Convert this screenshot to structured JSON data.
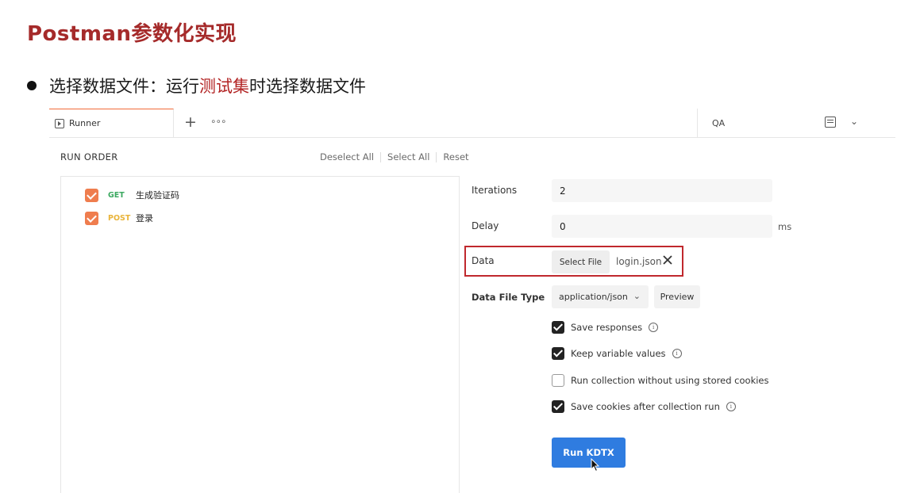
{
  "slide": {
    "title": "Postman参数化实现",
    "bullet_prefix": "选择数据文件：运行",
    "bullet_highlight": "测试集",
    "bullet_suffix": "时选择数据文件"
  },
  "tabs": {
    "runner_label": "Runner",
    "add_tab": "+",
    "more": "∘∘∘",
    "environment": "QA",
    "environment_chevron": "⌄"
  },
  "run_order": {
    "title": "RUN ORDER",
    "deselect_all": "Deselect All",
    "select_all": "Select All",
    "reset": "Reset",
    "requests": [
      {
        "method": "GET",
        "name": "生成验证码",
        "checked": true
      },
      {
        "method": "POST",
        "name": "登录",
        "checked": true
      }
    ]
  },
  "settings": {
    "iterations_label": "Iterations",
    "iterations_value": "2",
    "delay_label": "Delay",
    "delay_value": "0",
    "delay_unit": "ms",
    "data_label": "Data",
    "select_file_label": "Select File",
    "file_name": "login.json",
    "data_file_type_label": "Data File Type",
    "data_file_type_value": "application/json",
    "preview_label": "Preview",
    "options": [
      {
        "label": "Save responses",
        "checked": true,
        "info": true
      },
      {
        "label": "Keep variable values",
        "checked": true,
        "info": true
      },
      {
        "label": "Run collection without using stored cookies",
        "checked": false,
        "info": false
      },
      {
        "label": "Save cookies after collection run",
        "checked": true,
        "info": true
      }
    ],
    "run_button_label": "Run KDTX"
  },
  "colors": {
    "title": "#a52a2a",
    "highlight": "#b22222",
    "accent_orange": "#ef7d4e",
    "run_blue": "#2f7ce0",
    "get_green": "#3aa85f",
    "post_yellow": "#e9b43a",
    "annotation_red": "#c0282d"
  }
}
